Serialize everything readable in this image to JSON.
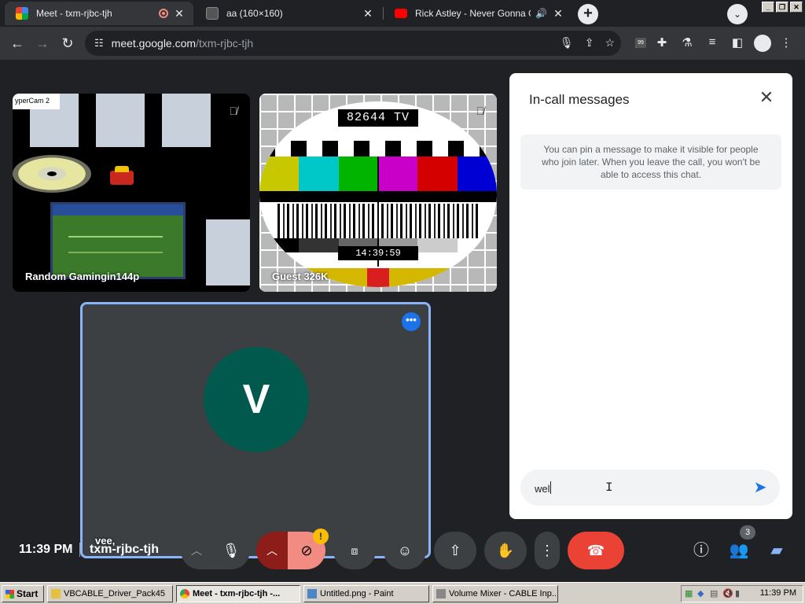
{
  "browser": {
    "tabs": [
      {
        "title": "Meet - txm-rjbc-tjh",
        "favicon_color": "#00ac47"
      },
      {
        "title": "aa (160×160)",
        "favicon_color": "#555555"
      },
      {
        "title": "Rick Astley - Never Gonna Give",
        "favicon_color": "#ff0000"
      }
    ],
    "url_host": "meet.google.com",
    "url_path": "/txm-rjbc-tjh",
    "extension_badge": "99",
    "new_tab": "+",
    "tab_search": "⌄"
  },
  "meet": {
    "tiles": [
      {
        "name": "Random Gamingin144p",
        "overlay_label": "yperCam 2"
      },
      {
        "name": "Guest 326K",
        "tv_label": "82644 TV",
        "tv_time": "14:39:59"
      },
      {
        "name": "vee,",
        "avatar_letter": "V"
      }
    ],
    "chat": {
      "title": "In-call messages",
      "note": "You can pin a message to make it visible for people who join later. When you leave the call, you won't be able to access this chat.",
      "input_value": "wel"
    },
    "bottom": {
      "time": "11:39 PM",
      "meeting_code": "txm-rjbc-tjh",
      "people_count": "3",
      "camera_warning": "!"
    },
    "colors": {
      "accent": "#1a73e8",
      "leave": "#ea4335",
      "avatar": "#00594c",
      "camera_off": "#f28b82"
    }
  },
  "taskbar": {
    "start_label": "Start",
    "tasks": [
      {
        "label": "VBCABLE_Driver_Pack45"
      },
      {
        "label": "Meet - txm-rjbc-tjh -..."
      },
      {
        "label": "Untitled.png - Paint"
      },
      {
        "label": "Volume Mixer - CABLE Inp..."
      }
    ],
    "clock": "11:39 PM"
  }
}
